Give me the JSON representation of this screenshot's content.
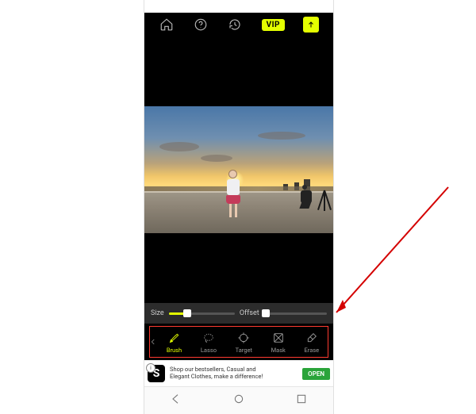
{
  "topbar": {
    "home_icon": "home-icon",
    "help_icon": "help-icon",
    "history_icon": "history-icon",
    "vip_label": "VIP",
    "export_icon": "export-icon"
  },
  "sliders": {
    "size_label": "Size",
    "size_value_pct": 28,
    "offset_label": "Offset",
    "offset_value_pct": 3
  },
  "tools": [
    {
      "id": "brush",
      "label": "Brush",
      "active": true
    },
    {
      "id": "lasso",
      "label": "Lasso",
      "active": false
    },
    {
      "id": "target",
      "label": "Target",
      "active": false
    },
    {
      "id": "mask",
      "label": "Mask",
      "active": false
    },
    {
      "id": "erase",
      "label": "Erase",
      "active": false
    }
  ],
  "ad": {
    "badge_letter": "S",
    "line1": "Shop our bestsellers, Casual and",
    "line2": "Elegant Clothes, make a difference!",
    "cta": "OPEN"
  },
  "accent_color": "#e4ff00",
  "highlight_color": "#ff3b30"
}
